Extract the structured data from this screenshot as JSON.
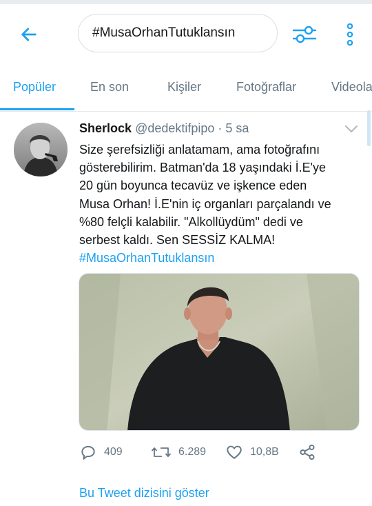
{
  "search": {
    "query": "#MusaOrhanTutuklansın"
  },
  "tabs": [
    {
      "label": "Popüler",
      "active": true
    },
    {
      "label": "En son"
    },
    {
      "label": "Kişiler"
    },
    {
      "label": "Fotoğraflar"
    },
    {
      "label": "Videola"
    }
  ],
  "tweet": {
    "author_name": "Sherlock",
    "handle": "@dedektifpipo",
    "separator": " · ",
    "time": "5 sa",
    "text_lines": [
      "Size şerefsizliği anlatamam, ama fotoğrafını",
      "gösterebilirim. Batman'da 18 yaşındaki İ.E'ye",
      "20 gün boyunca tecavüz ve işkence eden",
      "Musa Orhan! İ.E'nin iç organları parçalandı ve",
      "%80 felçli kalabilir. \"Alkollüydüm\" dedi ve",
      "serbest kaldı. Sen SESSİZ KALMA!"
    ],
    "hashtag": "#MusaOrhanTutuklansın",
    "replies": "409",
    "retweets": "6.289",
    "likes": "10,8B",
    "show_thread": "Bu Tweet dizisini göster"
  },
  "colors": {
    "accent": "#1da1f2",
    "text": "#14171a",
    "muted": "#657786",
    "divider": "#e1e8ed"
  },
  "icons": {
    "back": "arrow-left-icon",
    "filter": "sliders-icon",
    "more": "more-vertical-icon",
    "caret": "chevron-down-icon",
    "reply": "speech-bubble-icon",
    "retweet": "retweet-icon",
    "like": "heart-icon",
    "share": "share-icon"
  }
}
